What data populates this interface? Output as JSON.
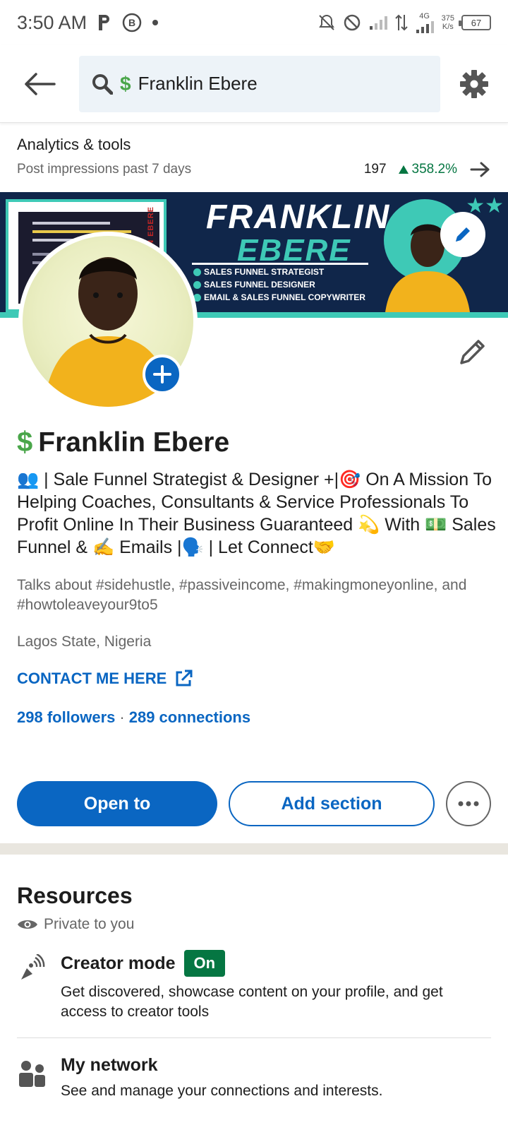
{
  "status_bar": {
    "time": "3:50 AM",
    "net_speed_value": "375",
    "net_speed_unit": "K/s",
    "network_type": "4G",
    "battery": "67"
  },
  "search": {
    "value": "Franklin Ebere"
  },
  "analytics": {
    "title": "Analytics & tools",
    "subtitle": "Post impressions past 7 days",
    "value": "197",
    "change": "358.2%"
  },
  "banner": {
    "name_line1": "FRANKLIN",
    "name_line2": "EBERE",
    "vertical_text": "N EBERE",
    "bullets": [
      "SALES FUNNEL STRATEGIST",
      "SALES FUNNEL DESIGNER",
      "EMAIL & SALES FUNNEL COPYWRITER"
    ]
  },
  "profile": {
    "name": "Franklin Ebere",
    "headline": "👥 | Sale Funnel Strategist & Designer +|🎯 On A Mission To Helping Coaches, Consultants & Service Professionals To Profit Online In Their Business Guaranteed 💫 With 💵 Sales Funnel & ✍️ Emails |🗣️ | Let Connect🤝",
    "talks_about": "Talks about #sidehustle, #passiveincome, #makingmoneyonline, and #howtoleaveyour9to5",
    "location": "Lagos State, Nigeria",
    "contact_label": "CONTACT ME HERE",
    "followers": "298 followers",
    "connections": "289 connections"
  },
  "actions": {
    "open_to": "Open to",
    "add_section": "Add section"
  },
  "resources": {
    "title": "Resources",
    "private_label": "Private to you",
    "items": [
      {
        "title": "Creator mode",
        "badge": "On",
        "description": "Get discovered, showcase content on your profile, and get access to creator tools"
      },
      {
        "title": "My network",
        "description": "See and manage your connections and interests."
      }
    ]
  },
  "colors": {
    "accent": "#0a66c2",
    "positive": "#057642",
    "banner_bg": "#10264a",
    "banner_teal": "#3ec9b6"
  }
}
